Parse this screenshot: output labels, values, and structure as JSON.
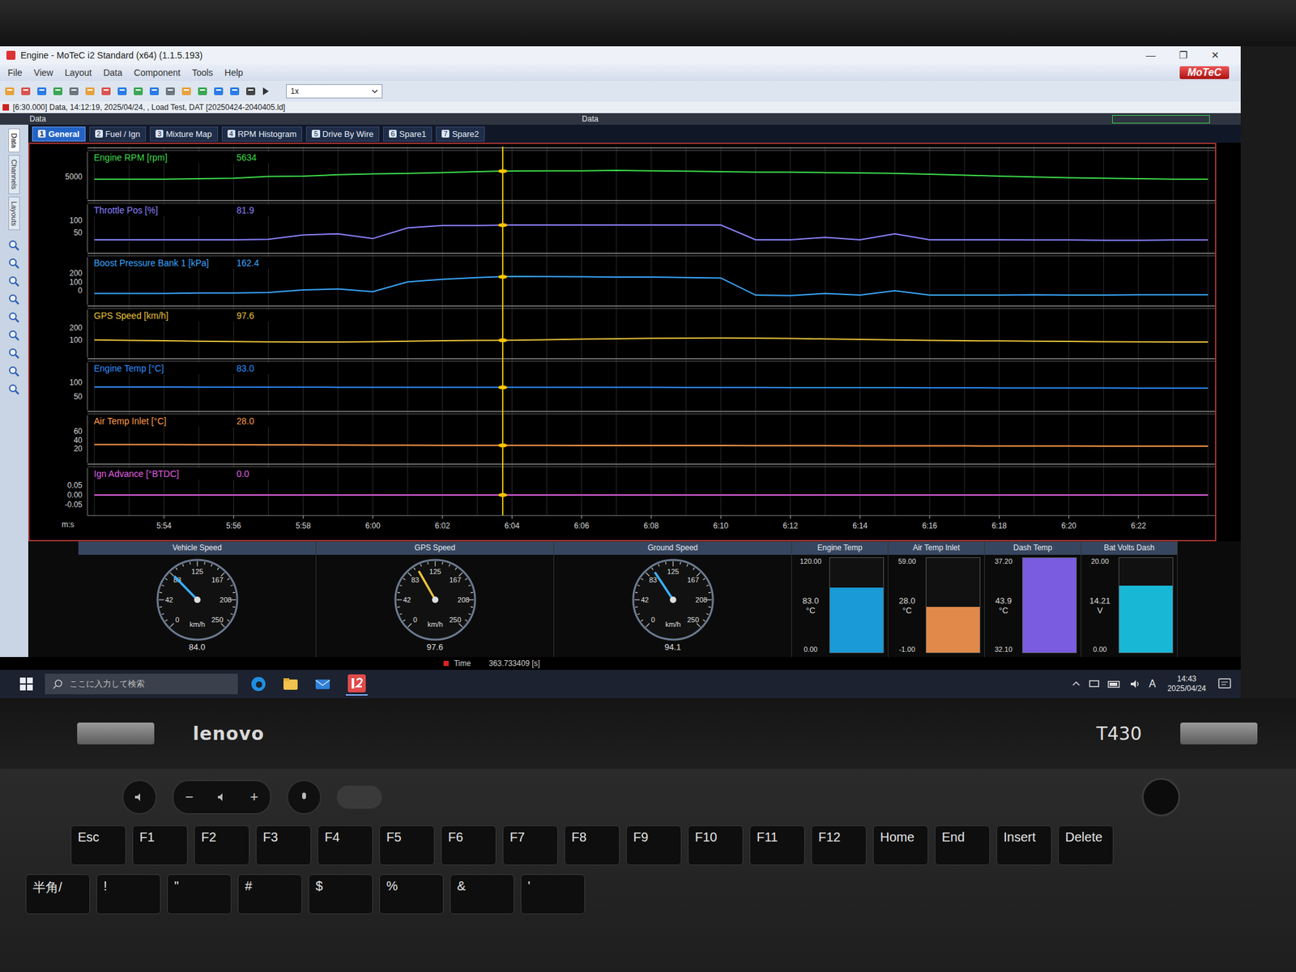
{
  "window": {
    "title": "Engine - MoTeC i2 Standard (x64) (1.1.5.193)",
    "controls": [
      "—",
      "❐",
      "✕"
    ],
    "brand": "MoTeC"
  },
  "menu": [
    "File",
    "View",
    "Layout",
    "Data",
    "Component",
    "Tools",
    "Help"
  ],
  "toolbar": {
    "zoom": "1x"
  },
  "file_info": "[6:30.000] Data, 14:12:19, 2025/04/24, , Load Test, DAT [20250424-2040405.ld]",
  "data_headers": [
    "Data",
    "Data"
  ],
  "side_tabs": [
    {
      "label": "Data",
      "selected": true
    },
    {
      "label": "Channels",
      "selected": false
    },
    {
      "label": "Layouts",
      "selected": false
    }
  ],
  "tabs": [
    {
      "number": "1",
      "label": "General",
      "selected": true
    },
    {
      "number": "2",
      "label": "Fuel / Ign",
      "selected": false
    },
    {
      "number": "3",
      "label": "Mixture Map",
      "selected": false
    },
    {
      "number": "4",
      "label": "RPM Histogram",
      "selected": false
    },
    {
      "number": "5",
      "label": "Drive By Wire",
      "selected": false
    },
    {
      "number": "6",
      "label": "Spare1",
      "selected": false
    },
    {
      "number": "7",
      "label": "Spare2",
      "selected": false
    }
  ],
  "chart": {
    "time_start": 352,
    "time_step": 1,
    "cursor": {
      "time": 363.733409
    },
    "x_axis": {
      "unit": "m:s",
      "first_tick": 354,
      "tick_step": 2,
      "ticks": [
        "5:54",
        "5:56",
        "5:58",
        "6:00",
        "6:02",
        "6:04",
        "6:06",
        "6:08",
        "6:10",
        "6:12",
        "6:14",
        "6:16",
        "6:18",
        "6:20",
        "6:22"
      ]
    },
    "series": [
      {
        "name": "Engine RPM [rpm]",
        "reading": "5634",
        "color": "#3ddc4a",
        "ticks": [
          "5000"
        ],
        "axis_min": 3000,
        "axis_max": 6500,
        "values": [
          4700,
          4700,
          4700,
          4750,
          4800,
          5000,
          5050,
          5200,
          5300,
          5350,
          5450,
          5550,
          5634,
          5650,
          5650,
          5700,
          5650,
          5600,
          5550,
          5500,
          5500,
          5450,
          5400,
          5350,
          5250,
          5150,
          5050,
          4950,
          4850,
          4800,
          4750,
          4700,
          4700
        ]
      },
      {
        "name": "Throttle Pos [%]",
        "reading": "81.9",
        "color": "#8c82ff",
        "ticks": [
          "100",
          "50"
        ],
        "axis_min": -10,
        "axis_max": 120,
        "values": [
          20,
          20,
          20,
          20,
          20,
          22,
          40,
          45,
          25,
          70,
          80,
          80,
          82,
          82,
          82,
          82,
          82,
          82,
          82,
          20,
          20,
          30,
          20,
          45,
          20,
          20,
          20,
          19,
          19,
          18,
          18,
          19,
          19
        ]
      },
      {
        "name": "Boost Pressure Bank 1 [kPa]",
        "reading": "162.4",
        "color": "#3aa7ff",
        "ticks": [
          "200",
          "100",
          "0"
        ],
        "axis_min": -100,
        "axis_max": 250,
        "values": [
          -30,
          -30,
          -30,
          -25,
          -25,
          -20,
          10,
          20,
          -10,
          100,
          130,
          150,
          162,
          160,
          158,
          155,
          155,
          150,
          145,
          -50,
          -55,
          -30,
          -50,
          0,
          -50,
          -50,
          -50,
          -45,
          -50,
          -50,
          -45,
          -45,
          -45
        ]
      },
      {
        "name": "GPS Speed [km/h]",
        "reading": "97.6",
        "color": "#e8c23a",
        "ticks": [
          "200",
          "100"
        ],
        "axis_min": 0,
        "axis_max": 250,
        "values": [
          100,
          97,
          94,
          90,
          87,
          85,
          84,
          83,
          86,
          90,
          94,
          96,
          98,
          102,
          106,
          110,
          113,
          115,
          116,
          115,
          112,
          108,
          104,
          100,
          97,
          94,
          92,
          90,
          88,
          86,
          85,
          84,
          84
        ]
      },
      {
        "name": "Engine Temp [°C]",
        "reading": "83.0",
        "color": "#2f8fff",
        "ticks": [
          "100",
          "50"
        ],
        "axis_min": 20,
        "axis_max": 130,
        "values": [
          84,
          84,
          84,
          83.8,
          83.6,
          83.5,
          83.4,
          83.3,
          83.2,
          83.1,
          83,
          83,
          83,
          83,
          82.9,
          82.8,
          82.7,
          82.6,
          82.5,
          82.4,
          82.2,
          82,
          81.8,
          81.6,
          81.4,
          81.2,
          81,
          80.8,
          80.6,
          80.4,
          80.3,
          80.2,
          80
        ]
      },
      {
        "name": "Air Temp Inlet [°C]",
        "reading": "28.0",
        "color": "#ff9a4a",
        "ticks": [
          "60",
          "40",
          "20"
        ],
        "axis_min": 0,
        "axis_max": 70,
        "values": [
          30,
          30,
          29.8,
          29.6,
          29.4,
          29.2,
          29,
          28.8,
          28.6,
          28.4,
          28.2,
          28.1,
          28,
          28,
          27.9,
          27.8,
          27.7,
          27.6,
          27.5,
          27.4,
          27.3,
          27.2,
          27.1,
          27,
          26.9,
          26.8,
          26.7,
          26.6,
          26.5,
          26.4,
          26.3,
          26.2,
          26.1
        ]
      },
      {
        "name": "Ign Advance [°BTDC]",
        "reading": "0.0",
        "color": "#e060e0",
        "ticks": [
          "0.05",
          "0.00",
          "-0.05"
        ],
        "axis_min": -0.08,
        "axis_max": 0.08,
        "values": [
          0,
          0,
          0,
          0,
          0,
          0,
          0,
          0,
          0,
          0,
          0,
          0,
          0,
          0,
          0,
          0,
          0,
          0,
          0,
          0,
          0,
          0,
          0,
          0,
          0,
          0,
          0,
          0,
          0,
          0,
          0,
          0,
          0
        ]
      }
    ]
  },
  "dials": [
    {
      "title": "Vehicle Speed",
      "reading": "84.0",
      "unit": "km/h",
      "level": 0.336,
      "needle_color": "#3ab0ff",
      "labels": [
        "0",
        "42",
        "83",
        "125",
        "167",
        "208",
        "250"
      ]
    },
    {
      "title": "GPS Speed",
      "reading": "97.6",
      "unit": "km/h",
      "level": 0.39,
      "needle_color": "#e8c23a",
      "labels": [
        "0",
        "42",
        "83",
        "125",
        "167",
        "208",
        "250"
      ]
    },
    {
      "title": "Ground Speed",
      "reading": "94.1",
      "unit": "km/h",
      "level": 0.376,
      "needle_color": "#3ab0ff",
      "labels": [
        "0",
        "42",
        "83",
        "125",
        "167",
        "208",
        "250"
      ]
    }
  ],
  "bars": [
    {
      "title": "Engine Temp",
      "max": "120.00",
      "reading": "83.0",
      "unit": "°C",
      "min": "0.00",
      "level": 0.69,
      "color": "#1a9ad6"
    },
    {
      "title": "Air Temp Inlet",
      "max": "59.00",
      "reading": "28.0",
      "unit": "°C",
      "min": "-1.00",
      "level": 0.48,
      "color": "#e0894a"
    },
    {
      "title": "Dash Temp",
      "max": "37.20",
      "reading": "43.9",
      "unit": "°C",
      "min": "32.10",
      "level": 1.0,
      "color": "#7a5ce0"
    },
    {
      "title": "Bat Volts Dash",
      "max": "20.00",
      "reading": "14.21",
      "unit": "V",
      "min": "0.00",
      "level": 0.71,
      "color": "#19b7d6"
    }
  ],
  "status": {
    "label": "Time",
    "value": "363.733409 [s]"
  },
  "taskbar": {
    "search_placeholder": "ここに入力して検索",
    "ime": "A",
    "time": "14:43",
    "date": "2025/04/24"
  },
  "laptop": {
    "brand": "lenovo",
    "model": "T430",
    "volume_down": "−",
    "volume_up": "+",
    "keys": [
      "Esc",
      "F1",
      "F2",
      "F3",
      "F4",
      "F5",
      "F6",
      "F7",
      "F8",
      "F9",
      "F10",
      "F11",
      "F12",
      "Home",
      "End",
      "Insert",
      "Delete"
    ],
    "bottom_keys": [
      "半角/",
      "!",
      "\"",
      "#",
      "$",
      "%",
      "&",
      "'"
    ]
  }
}
